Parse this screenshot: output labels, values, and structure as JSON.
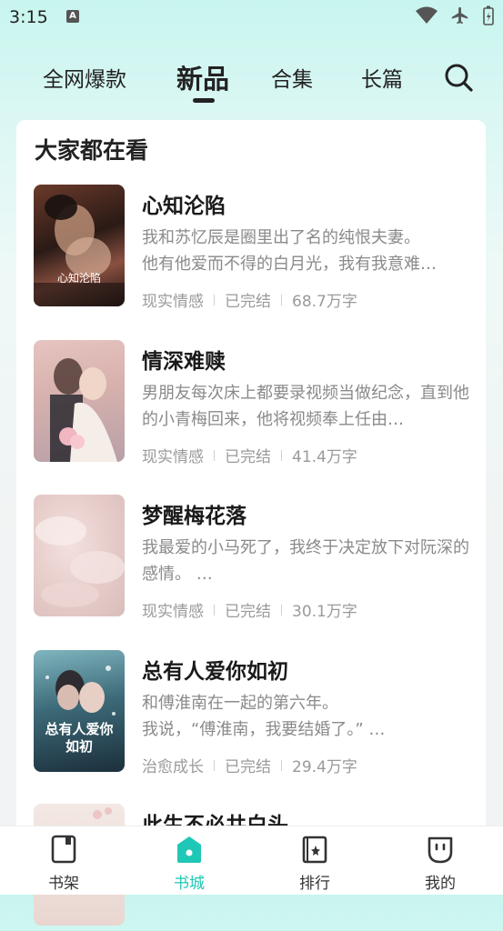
{
  "status_bar": {
    "time": "3:15",
    "notification_icon": "A"
  },
  "top_nav": {
    "tabs": [
      {
        "label": "全网爆款"
      },
      {
        "label": "新品"
      },
      {
        "label": "合集"
      },
      {
        "label": "长篇"
      }
    ],
    "active_tab": "新品"
  },
  "section": {
    "title": "大家都在看"
  },
  "books": [
    {
      "title": "心知沦陷",
      "desc": "我和苏忆辰是圈里出了名的纯恨夫妻。\n他有他爱而不得的白月光，我有我意难…",
      "genre": "现实情感",
      "status": "已完结",
      "words": "68.7万字",
      "cover_text": "心知沦陷"
    },
    {
      "title": "情深难赎",
      "desc": "男朋友每次床上都要录视频当做纪念，直到他的小青梅回来，他将视频奉上任由…",
      "genre": "现实情感",
      "status": "已完结",
      "words": "41.4万字",
      "cover_text": ""
    },
    {
      "title": "梦醒梅花落",
      "desc": "我最爱的小马死了，我终于决定放下对阮深的感情。 …",
      "genre": "现实情感",
      "status": "已完结",
      "words": "30.1万字",
      "cover_text": ""
    },
    {
      "title": "总有人爱你如初",
      "desc": "和傅淮南在一起的第六年。\n我说，“傅淮南，我要结婚了。” …",
      "genre": "治愈成长",
      "status": "已完结",
      "words": "29.4万字",
      "cover_text": "总有人爱你如初"
    },
    {
      "title": "此生不必共白头",
      "desc": "",
      "genre": "",
      "status": "",
      "words": "",
      "cover_text": ""
    }
  ],
  "bottom_nav": {
    "items": [
      {
        "label": "书架",
        "icon": "bookshelf-icon"
      },
      {
        "label": "书城",
        "icon": "bookstore-icon"
      },
      {
        "label": "排行",
        "icon": "ranking-icon"
      },
      {
        "label": "我的",
        "icon": "profile-icon"
      }
    ],
    "active": "书城"
  },
  "colors": {
    "accent": "#1fc7b6",
    "text": "#222222",
    "muted": "#8a8a8a"
  }
}
